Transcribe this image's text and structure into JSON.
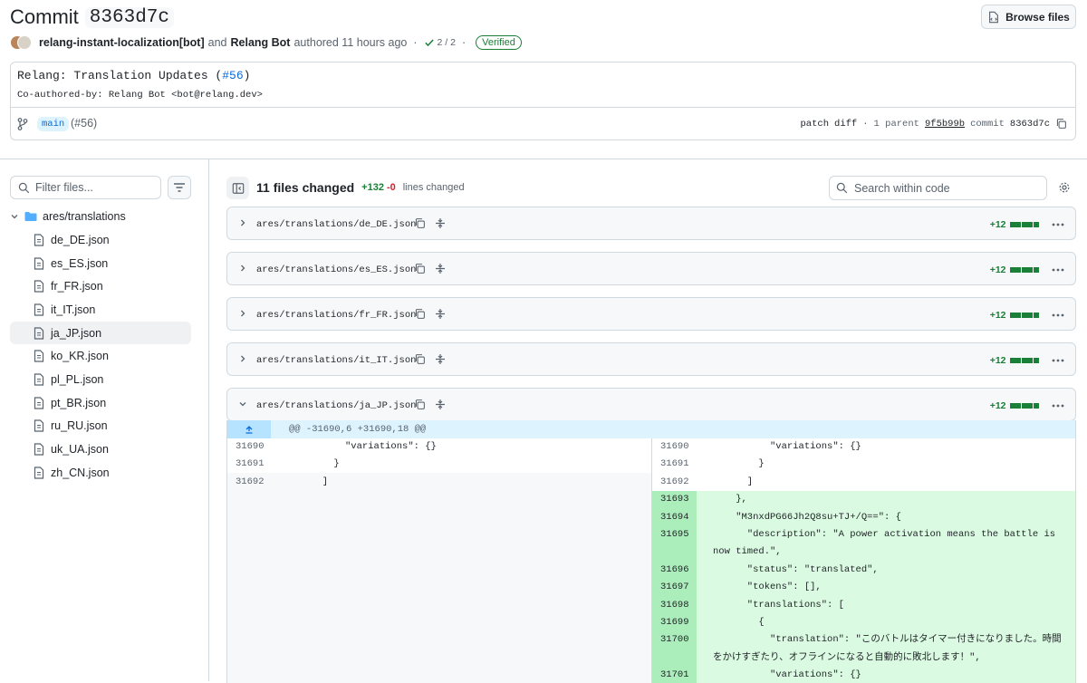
{
  "header": {
    "title_word": "Commit",
    "sha": "8363d7c",
    "browse_label": "Browse files",
    "author1": "relang-instant-localization[bot]",
    "and_word": "and",
    "author2": "Relang Bot",
    "authored": "authored 11 hours ago",
    "checks": "2 / 2",
    "verified": "Verified"
  },
  "message": {
    "title_prefix": "Relang: Translation Updates (",
    "title_link": "#56",
    "title_suffix": ")",
    "body": "Co-authored-by: Relang Bot <bot@relang.dev>",
    "branch": "main",
    "pr": "(#56)",
    "patch": "patch",
    "diff": "diff",
    "parent_count": "1 parent",
    "parent_sha": "9f5b99b",
    "commit_word": "commit",
    "commit_sha": "8363d7c"
  },
  "sidebar": {
    "filter_placeholder": "Filter files...",
    "dir": "ares/translations",
    "files": [
      "de_DE.json",
      "es_ES.json",
      "fr_FR.json",
      "it_IT.json",
      "ja_JP.json",
      "ko_KR.json",
      "pl_PL.json",
      "pt_BR.json",
      "ru_RU.json",
      "uk_UA.json",
      "zh_CN.json"
    ],
    "selected": "ja_JP.json"
  },
  "toolbar": {
    "files_changed": "11 files changed",
    "additions": "+132",
    "deletions": "-0",
    "lines_changed": "lines changed",
    "search_placeholder": "Search within code"
  },
  "diff_files": [
    {
      "path": "ares/translations/de_DE.json",
      "stat": "+12",
      "expanded": false
    },
    {
      "path": "ares/translations/es_ES.json",
      "stat": "+12",
      "expanded": false
    },
    {
      "path": "ares/translations/fr_FR.json",
      "stat": "+12",
      "expanded": false
    },
    {
      "path": "ares/translations/it_IT.json",
      "stat": "+12",
      "expanded": false
    },
    {
      "path": "ares/translations/ja_JP.json",
      "stat": "+12",
      "expanded": true
    }
  ],
  "hunk": {
    "header": "@@ -31690,6 +31690,18 @@",
    "left": [
      {
        "n": "31690",
        "code": "          \"variations\": {}"
      },
      {
        "n": "31691",
        "code": "        }"
      },
      {
        "n": "31692",
        "code": "      ]"
      }
    ],
    "right": [
      {
        "n": "31690",
        "code": "          \"variations\": {}",
        "add": false
      },
      {
        "n": "31691",
        "code": "        }",
        "add": false
      },
      {
        "n": "31692",
        "code": "      ]",
        "add": false
      },
      {
        "n": "31693",
        "code": "    },",
        "add": true
      },
      {
        "n": "31694",
        "code": "    \"M3nxdPG66Jh2Q8su+TJ+/Q==\": {",
        "add": true
      },
      {
        "n": "31695",
        "code": "      \"description\": \"A power activation means the battle is now timed.\",",
        "add": true,
        "wrap": true
      },
      {
        "n": "31696",
        "code": "      \"status\": \"translated\",",
        "add": true
      },
      {
        "n": "31697",
        "code": "      \"tokens\": [],",
        "add": true
      },
      {
        "n": "31698",
        "code": "      \"translations\": [",
        "add": true
      },
      {
        "n": "31699",
        "code": "        {",
        "add": true
      },
      {
        "n": "31700",
        "code": "          \"translation\": \"このバトルはタイマー付きになりました。時間をかけすぎたり、オフラインになると自動的に敗北します！\",",
        "add": true,
        "wrap": true
      },
      {
        "n": "31701",
        "code": "          \"variations\": {}",
        "add": true
      }
    ]
  }
}
